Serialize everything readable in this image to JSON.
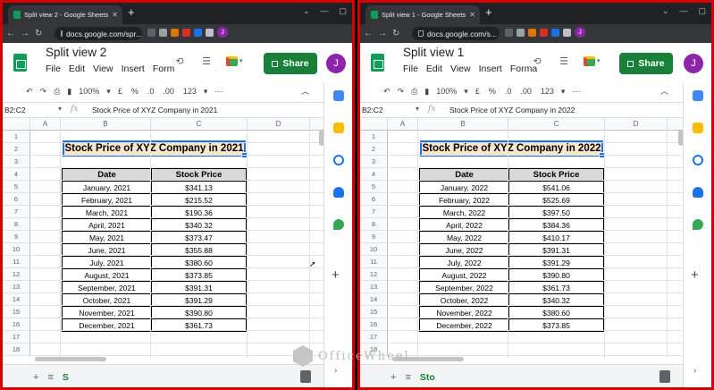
{
  "watermark": "OfficeWheel",
  "left": {
    "tab_title": "Split view 2 - Google Sheets",
    "url": "docs.google.com/spr...",
    "doc_title": "Split view 2",
    "menu": [
      "File",
      "Edit",
      "View",
      "Insert",
      "Form"
    ],
    "share_label": "Share",
    "avatar": "J",
    "profile": "J",
    "zoom": "100%",
    "toolbar_items": [
      "£",
      "%",
      ".0",
      ".00",
      "123"
    ],
    "name_box": "B2:C2",
    "formula": "Stock Price of XYZ Company in 2021",
    "columns": [
      "A",
      "B",
      "C",
      "D"
    ],
    "rows": [
      "1",
      "2",
      "3",
      "4",
      "5",
      "6",
      "7",
      "8",
      "9",
      "10",
      "11",
      "12",
      "13",
      "14",
      "15",
      "16",
      "17",
      "18"
    ],
    "sheet_title": "Stock Price of XYZ Company in 2021",
    "headers": [
      "Date",
      "Stock Price"
    ],
    "data": [
      [
        "January, 2021",
        "$341.13"
      ],
      [
        "February, 2021",
        "$215.52"
      ],
      [
        "March, 2021",
        "$190.36"
      ],
      [
        "April, 2021",
        "$340.32"
      ],
      [
        "May, 2021",
        "$373.47"
      ],
      [
        "June, 2021",
        "$355.88"
      ],
      [
        "July, 2021",
        "$380.60"
      ],
      [
        "August, 2021",
        "$373.85"
      ],
      [
        "September, 2021",
        "$391.31"
      ],
      [
        "October, 2021",
        "$391.29"
      ],
      [
        "November, 2021",
        "$390.80"
      ],
      [
        "December, 2021",
        "$361.73"
      ]
    ],
    "sheet_tab": "S"
  },
  "right": {
    "tab_title": "Split view 1 - Google Sheets",
    "url": "docs.google.com/s...",
    "doc_title": "Split view 1",
    "menu": [
      "File",
      "Edit",
      "View",
      "Insert",
      "Forma"
    ],
    "share_label": "Share",
    "avatar": "J",
    "profile": "J",
    "zoom": "100%",
    "toolbar_items": [
      "£",
      "%",
      ".0",
      ".00",
      "123"
    ],
    "name_box": "B2:C2",
    "formula": "Stock Price of XYZ Company in 2022",
    "columns": [
      "A",
      "B",
      "C",
      "D"
    ],
    "rows": [
      "1",
      "2",
      "3",
      "4",
      "5",
      "6",
      "7",
      "8",
      "9",
      "10",
      "11",
      "12",
      "13",
      "14",
      "15",
      "16",
      "17",
      "18"
    ],
    "sheet_title": "Stock Price of XYZ Company in 2022",
    "headers": [
      "Date",
      "Stock Price"
    ],
    "data": [
      [
        "January, 2022",
        "$541.06"
      ],
      [
        "February, 2022",
        "$525.69"
      ],
      [
        "March, 2022",
        "$397.50"
      ],
      [
        "April, 2022",
        "$384.36"
      ],
      [
        "May, 2022",
        "$410.17"
      ],
      [
        "June, 2022",
        "$391.31"
      ],
      [
        "July, 2022",
        "$391.29"
      ],
      [
        "August, 2022",
        "$390.80"
      ],
      [
        "September, 2022",
        "$361.73"
      ],
      [
        "October, 2022",
        "$340.32"
      ],
      [
        "November, 2022",
        "$380.60"
      ],
      [
        "December, 2022",
        "$373.85"
      ]
    ],
    "sheet_tab": "Sto"
  }
}
